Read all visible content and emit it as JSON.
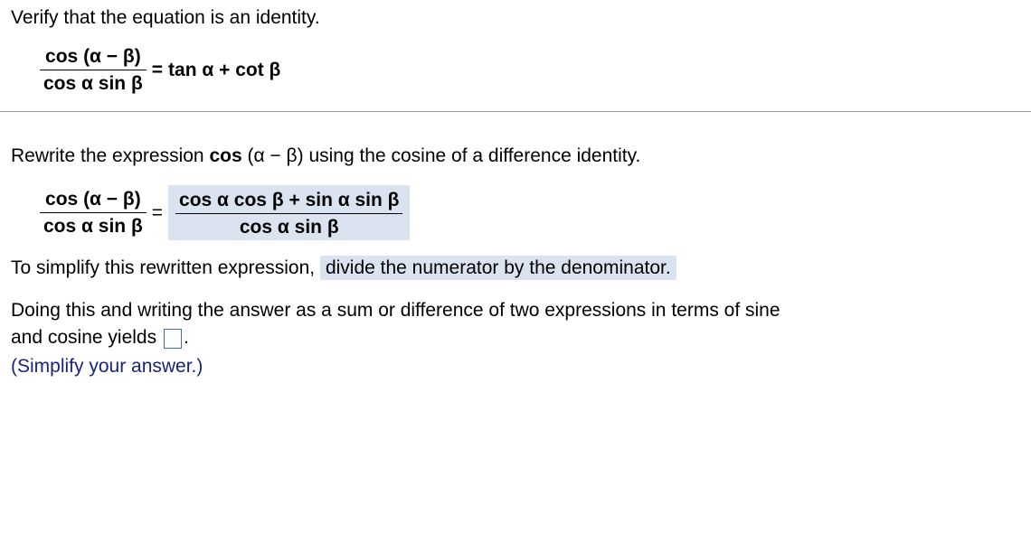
{
  "top": {
    "instruction": "Verify that the equation is an identity.",
    "lhs_num": "cos (α − β)",
    "lhs_den": "cos α sin β",
    "eq_sign": "=",
    "rhs": "tan α +  cot β"
  },
  "mid": {
    "rewrite_pre": "Rewrite the expression ",
    "rewrite_bold": "cos",
    "rewrite_arg": " (α − β) ",
    "rewrite_post": "using the cosine of a difference identity.",
    "lhs_num": "cos (α − β)",
    "lhs_den": "cos α sin β",
    "eq_sign": "=",
    "rhs_num": "cos α cos β +  sin α sin β",
    "rhs_den": "cos α sin β"
  },
  "bottom": {
    "simplify_pre": "To simplify this rewritten expression,  ",
    "simplify_hl": "divide the numerator by the denominator.",
    "yield_line_1": "Doing this and writing the answer as a sum or difference of two expressions in terms of sine",
    "yield_line_2a": "and cosine yields ",
    "yield_line_2b": ".",
    "simplify_hint": "(Simplify your answer.)"
  }
}
